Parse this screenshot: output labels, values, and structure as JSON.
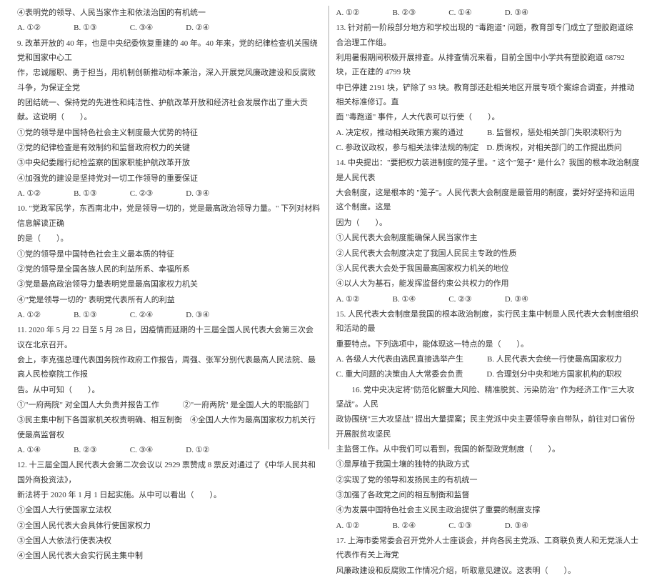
{
  "left": {
    "l1": "④表明党的领导、人民当家作主和依法治国的有机统一",
    "l2a": "A.  ①②",
    "l2b": "B.  ①③",
    "l2c": "C.  ③④",
    "l2d": "D.  ②④",
    "l3": "9.  改革开放的 40 年，也是中央纪委恢复重建的 40 年。40 年来，党的纪律检查机关围绕党和国家中心工",
    "l4": "作，忠诚履职、勇于担当，用机制创新推动标本兼治，深入开展党风廉政建设和反腐败斗争，为保证全党",
    "l5": "的团结统一、保持党的先进性和纯洁性、护航改革开放和经济社会发展作出了重大贡献。这说明（　　）。",
    "l6": "①党的领导是中国特色社会主义制度最大优势的特征",
    "l7": "②党的纪律检查是有效制约和监督政府权力的关键",
    "l8": "③中央纪委履行纪检监察的国家职能护航改革开放",
    "l9": "④加强党的建设是坚持党对一切工作领导的重要保证",
    "l10a": "A.  ①②",
    "l10b": "B.  ①③",
    "l10c": "C.  ②③",
    "l10d": "D.  ③④",
    "l11": "10.  \"党政军民学，东西南北中，党是领导一切的，党是最高政治领导力量。\" 下列对材料信息解读正确",
    "l12": "的是（　　）。",
    "l13": "①党的领导是中国特色社会主义最本质的特征",
    "l14": "②党的领导是全国各族人民的利益所系、幸福所系",
    "l15": "③党是最高政治领导力量表明党是最高国家权力机关",
    "l16": "④\"党是领导一切的\" 表明党代表所有人的利益",
    "l17a": "A.  ①②",
    "l17b": "B.  ①③",
    "l17c": "C.  ②④",
    "l17d": "D.  ③④",
    "l18": "11.  2020 年 5 月 22 日至 5 月 28 日，因疫情而延期的十三届全国人民代表大会第三次会议在北京召开。",
    "l19": "会上，李克强总理代表国务院作政府工作报告，周强、张军分别代表最高人民法院、最高人民检察院工作报",
    "l20": "告。从中可知（　　）。",
    "l21": "①\"一府两院\" 对全国人大负责并报告工作　　　②\"一府两院\" 是全国人大的职能部门",
    "l22": "③民主集中制下各国家机关权责明确、相互制衡　④全国人大作为最高国家权力机关行使最高监督权",
    "l23a": "A.  ①④",
    "l23b": "B.  ②③",
    "l23c": "C.  ③④",
    "l23d": "D.  ①②",
    "l24": "12.  十三届全国人民代表大会第二次会议以 2929 票赞成 8 票反对通过了《中华人民共和国外商投资法》，",
    "l25": "新法将于 2020 年 1 月 1 日起实施。从中可以看出（　　）。",
    "l26": "①全国人大行使国家立法权",
    "l27": "②全国人民代表大会具体行使国家权力",
    "l28": "③全国人大依法行使表决权",
    "l29": "④全国人民代表大会实行民主集中制"
  },
  "right": {
    "r1a": "A.  ①②",
    "r1b": "B.  ②③",
    "r1c": "C.  ①④",
    "r1d": "D.  ③④",
    "r2": "13.  针对前一阶段部分地方和学校出现的 \"毒跑道\" 问题，教育部专门成立了塑胶跑道综合治理工作组。",
    "r3": "利用暑假期间积极开展排查。从排查情况来看，目前全国中小学共有塑胶跑道 68792 块，正在建的 4799 块",
    "r4": "中已停建 2191 块，铲除了 93 块。教育部还赴相关地区开展专项个案综合调查，并推动相关标准修订。直",
    "r5": "面 \"毒跑道\" 事件，人大代表可以行使（　　）。",
    "r6": "A.  决定权，推动相关政策方案的通过　　　B.  监督权，惩处相关部门失职渎职行为",
    "r7": "C.  参政议政权，参与相关法律法规的制定　D.  质询权，对相关部门的工作提出质问",
    "r8": "14.  中央提出：\"要把权力装进制度的笼子里。\" 这个\"笼子\" 是什么？我国的根本政治制度是人民代表",
    "r9": "大会制度，这是根本的 \"笼子\"。人民代表大会制度是最管用的制度，要好好坚持和运用这个制度。这是",
    "r10": "因为（　　）。",
    "r11": "①人民代表大会制度能确保人民当家作主",
    "r12": "②人民代表大会制度决定了我国人民民主专政的性质",
    "r13": "③人民代表大会处于我国最高国家权力机关的地位",
    "r14": "④以人大为基石，能发挥监督约束公共权力的作用",
    "r15a": "A.  ①②",
    "r15b": "B.  ①④",
    "r15c": "C.  ②③",
    "r15d": "D.  ③④",
    "r16": "15.  人民代表大会制度是我国的根本政治制度，实行民主集中制是人民代表大会制度组织和活动的最",
    "r17": "重要特点。下列选项中，能体现这一特点的是（　　）。",
    "r18": "A.  各级人大代表由选民直接选举产生　　　B.  人民代表大会统一行使最高国家权力",
    "r19": "C.  重大问题的决策由人大常委会负责　　　D.  合理划分中央和地方国家机构的职权",
    "r20": "　　16.  党中央决定将\"防范化解重大风险、精准脱贫、污染防治\" 作为经济工作\"三大攻坚战\"。人民",
    "r21": "政协围绕\"三大攻坚战\" 提出大量提案；民主党派中央主要领导亲自带队，前往对口省份开展脱贫攻坚民",
    "r22": "主监督工作。从中我们可以看到，我国的新型政党制度（　　）。",
    "r23": "①是厚植于我国土壤的独特的执政方式",
    "r24": "②实现了党的领导和发扬民主的有机统一",
    "r25": "③加强了各政党之间的相互制衡和监督",
    "r26": "④为发展中国特色社会主义民主政治提供了重要的制度支撑",
    "r27a": "A.  ①②",
    "r27b": "B.  ②④",
    "r27c": "C.  ①③",
    "r27d": "D.  ③④",
    "r28": "17.  上海市委常委会召开党外人士座谈会，并向各民主党派、工商联负责人和无党派人士代表作有关上海党",
    "r29": "风廉政建设和反腐败工作情况介绍，听取意见建议。这表明（　　）。"
  }
}
